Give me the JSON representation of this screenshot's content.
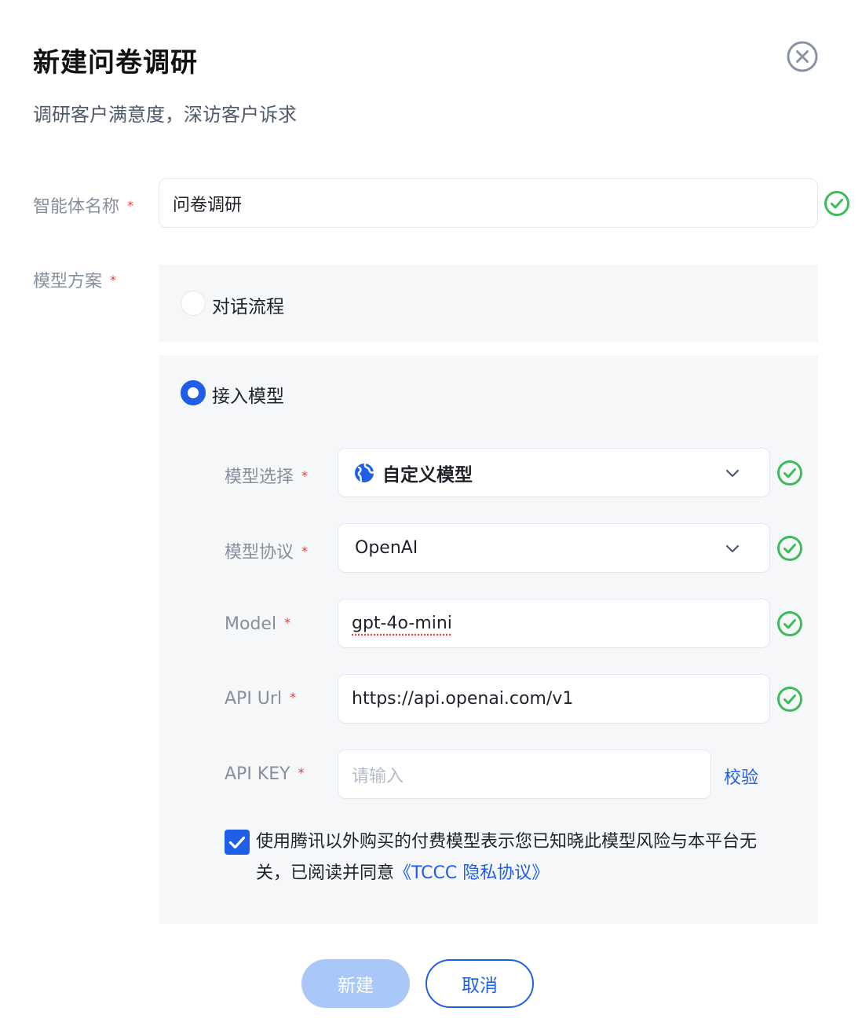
{
  "dialog": {
    "title": "新建问卷调研",
    "subtitle": "调研客户满意度，深访客户诉求"
  },
  "form": {
    "required_mark": "*",
    "agent_name": {
      "label": "智能体名称",
      "value": "问卷调研"
    },
    "model_scheme": {
      "label": "模型方案",
      "options": [
        {
          "label": "对话流程",
          "selected": false
        },
        {
          "label": "接入模型",
          "selected": true
        }
      ]
    },
    "model_select": {
      "label": "模型选择",
      "value": "自定义模型",
      "icon": "globe-icon"
    },
    "model_protocol": {
      "label": "模型协议",
      "value": "OpenAI"
    },
    "model": {
      "label": "Model",
      "value": "gpt-4o-mini"
    },
    "api_url": {
      "label": "API Url",
      "value": "https://api.openai.com/v1"
    },
    "api_key": {
      "label": "API KEY",
      "value": "",
      "placeholder": "请输入",
      "verify_label": "校验"
    },
    "agreement": {
      "checked": true,
      "text": "使用腾讯以外购买的付费模型表示您已知晓此模型风险与本平台无关，已阅读并同意",
      "link": "《TCCC 隐私协议》"
    }
  },
  "footer": {
    "create_label": "新建",
    "cancel_label": "取消"
  },
  "colors": {
    "primary": "#1f5ee7",
    "success": "#3dbc5a",
    "required": "#e53e3e",
    "disabled_primary": "#a9c8f7"
  }
}
